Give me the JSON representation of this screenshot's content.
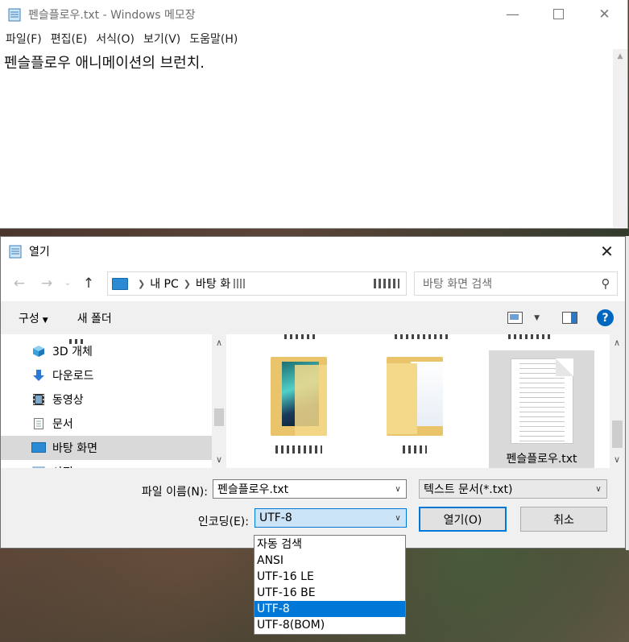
{
  "notepad": {
    "title": "펜슬플로우.txt - Windows 메모장",
    "menu": [
      "파일(F)",
      "편집(E)",
      "서식(O)",
      "보기(V)",
      "도움말(H)"
    ],
    "content": "펜슬플로우 애니메이션의 브런치."
  },
  "dialog": {
    "title": "열기",
    "address": [
      "내 PC",
      "바탕 화"
    ],
    "search_placeholder": "바탕 화면 검색",
    "organize": "구성",
    "new_folder": "새 폴더",
    "help": "?",
    "tree": [
      {
        "label": "3D 개체",
        "icon": "cube-icon"
      },
      {
        "label": "다운로드",
        "icon": "download-icon"
      },
      {
        "label": "동영상",
        "icon": "video-icon"
      },
      {
        "label": "문서",
        "icon": "document-icon"
      },
      {
        "label": "바탕 화면",
        "icon": "desktop-icon"
      },
      {
        "label": "사진",
        "icon": "pictures-icon"
      }
    ],
    "selected_file": "펜슬플로우.txt",
    "filename_label": "파일 이름(N):",
    "filename_value": "펜슬플로우.txt",
    "filetype_value": "텍스트 문서(*.txt)",
    "encoding_label": "인코딩(E):",
    "encoding_value": "UTF-8",
    "open_button": "열기(O)",
    "cancel_button": "취소",
    "encoding_options": [
      "자동 검색",
      "ANSI",
      "UTF-16 LE",
      "UTF-16 BE",
      "UTF-8",
      "UTF-8(BOM)"
    ],
    "selected_encoding_index": 4
  },
  "colors": {
    "accent": "#0078d7",
    "selection": "#d9d9d9"
  }
}
